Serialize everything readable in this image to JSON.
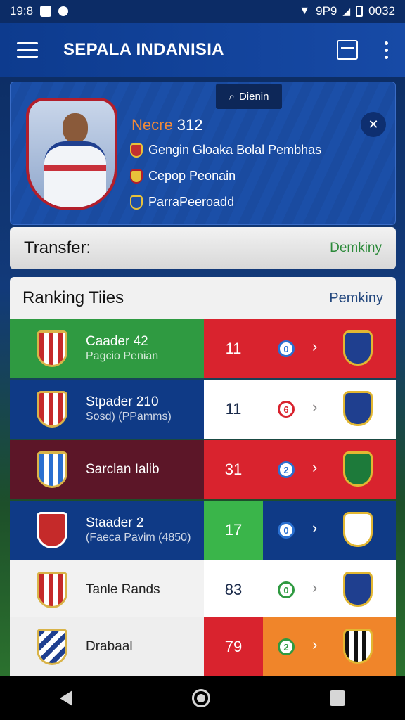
{
  "status_bar": {
    "time": "19:8",
    "signal_text": "9P9",
    "battery_text": "0032"
  },
  "app_bar": {
    "title": "SEPALA INDANISIA"
  },
  "hero": {
    "search_label": "Dienin",
    "name_accent": "Necre",
    "name_rest": " 312",
    "info_rows": [
      "Gengin Gloaka Bolal Pembhas",
      "Cepop Peonain",
      "ParraPeeroadd"
    ]
  },
  "transfer": {
    "title": "Transfer:",
    "link": "Demkiny"
  },
  "ranking": {
    "title": "Ranking Tiies",
    "link": "Pemkiny",
    "rows": [
      {
        "name": "Caader 42",
        "sub": "Pagcio Penian",
        "score": "11",
        "icon": "0"
      },
      {
        "name": "Stpader 210",
        "sub": "Sosd) (PPamms)",
        "score": "11",
        "icon": "6"
      },
      {
        "name": "Sarclan Ialib",
        "sub": "",
        "score": "31",
        "icon": "2"
      },
      {
        "name": "Staader 2",
        "sub": "(Faeca Pavim (4850)",
        "score": "17",
        "icon": "0"
      },
      {
        "name": "Tanle Rands",
        "sub": "",
        "score": "83",
        "icon": "0"
      },
      {
        "name": "Drabaal",
        "sub": "",
        "score": "79",
        "icon": "2"
      }
    ]
  },
  "colors": {
    "primary": "#0d3b8e",
    "green": "#2f9a41",
    "red": "#d9232e",
    "maroon": "#5c1628",
    "orange": "#f0852a"
  }
}
